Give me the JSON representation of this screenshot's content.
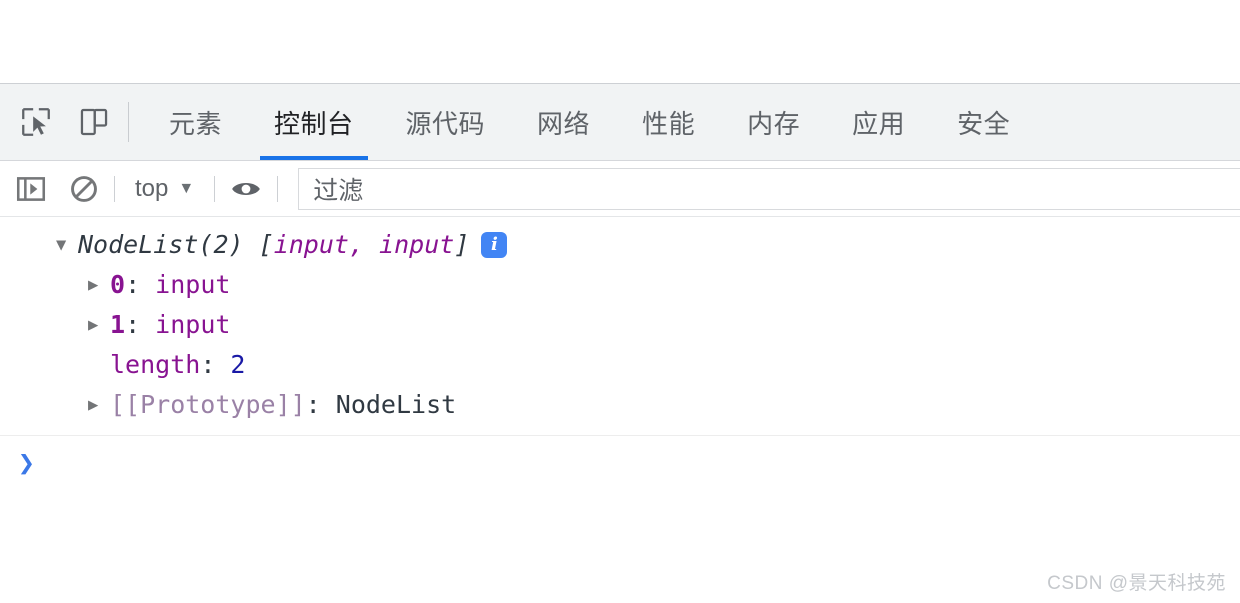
{
  "window": {
    "page_background": "#ffffff",
    "accent_color": "#1a73e8"
  },
  "tabbar": {
    "inspect_icon": "inspect-element-icon",
    "device_icon": "device-toolbar-icon",
    "tabs": [
      {
        "label": "元素",
        "active": false
      },
      {
        "label": "控制台",
        "active": true
      },
      {
        "label": "源代码",
        "active": false
      },
      {
        "label": "网络",
        "active": false
      },
      {
        "label": "性能",
        "active": false
      },
      {
        "label": "内存",
        "active": false
      },
      {
        "label": "应用",
        "active": false
      },
      {
        "label": "安全",
        "active": false
      }
    ]
  },
  "toolbar": {
    "sidebar_icon": "console-sidebar-icon",
    "clear_icon": "clear-console-icon",
    "context_value": "top",
    "context_caret": "▼",
    "eye_icon": "live-expression-eye-icon",
    "filter_placeholder": "过滤",
    "filter_value": "过滤"
  },
  "console": {
    "output": {
      "header": {
        "triangle": "▼",
        "constructor": "NodeList(2)",
        "open_bracket": " [",
        "items": "input, input",
        "close_bracket": "]",
        "badge": "i",
        "badge_name": "info-badge-icon"
      },
      "properties": [
        {
          "triangle": "▶",
          "expandable": true,
          "key": "0",
          "key_type": "index",
          "separator": ": ",
          "value": "input",
          "value_type": "node"
        },
        {
          "triangle": "▶",
          "expandable": true,
          "key": "1",
          "key_type": "index",
          "separator": ": ",
          "value": "input",
          "value_type": "node"
        },
        {
          "triangle": "",
          "expandable": false,
          "key": "length",
          "key_type": "plain",
          "separator": ": ",
          "value": "2",
          "value_type": "number"
        },
        {
          "triangle": "▶",
          "expandable": true,
          "key": "[[Prototype]]",
          "key_type": "proto",
          "separator": ": ",
          "value": "NodeList",
          "value_type": "proto"
        }
      ]
    },
    "prompt": {
      "chevron": "❯",
      "value": ""
    }
  },
  "watermark": "CSDN @景天科技苑"
}
